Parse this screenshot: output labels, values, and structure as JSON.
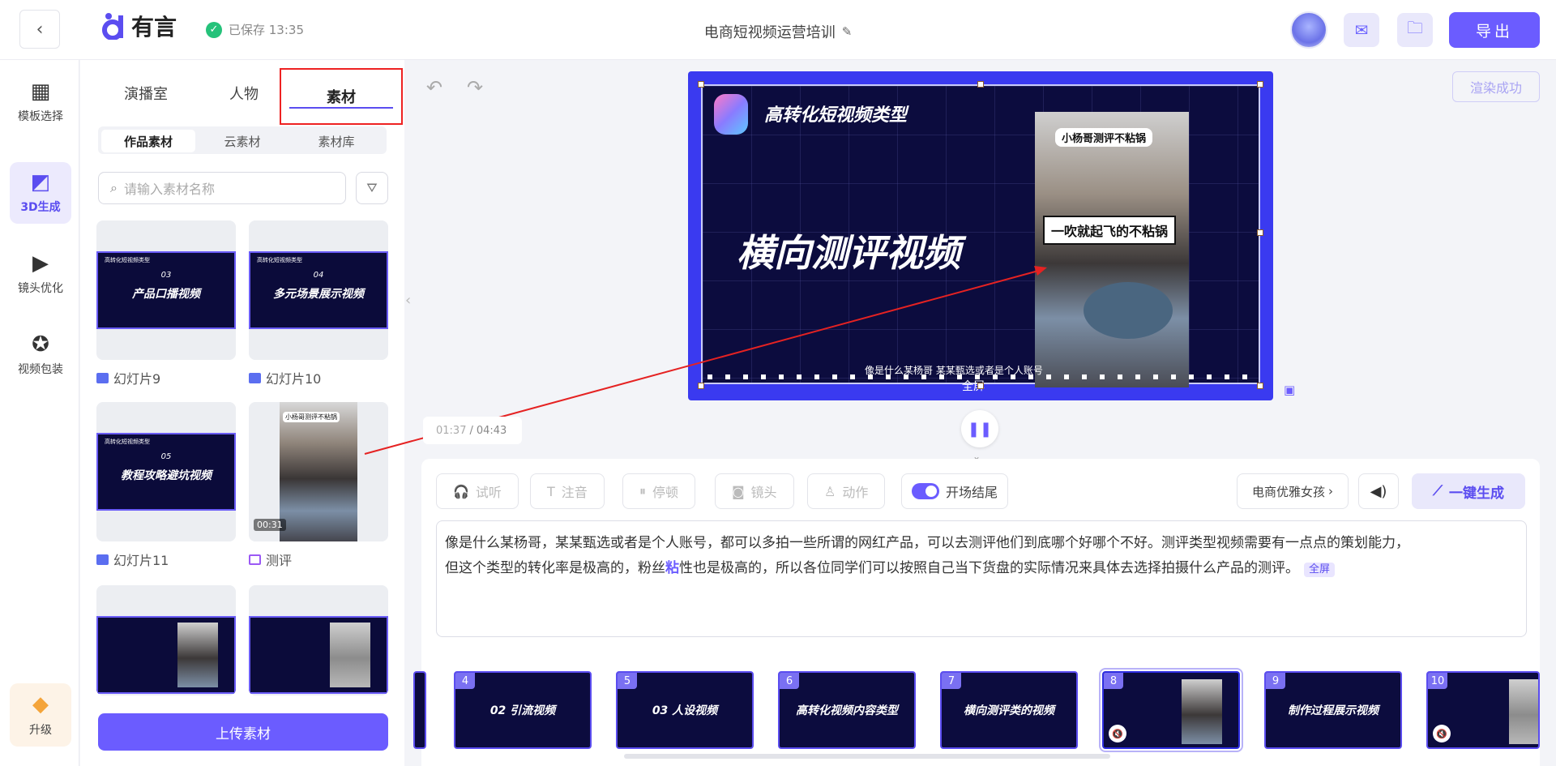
{
  "header": {
    "logo_text": "有言",
    "saved_text": "已保存 13:35",
    "project_title": "电商短视频运营培训",
    "export_label": "导出"
  },
  "rail": {
    "items": [
      {
        "label": "模板选择"
      },
      {
        "label": "3D生成"
      },
      {
        "label": "镜头优化"
      },
      {
        "label": "视频包装"
      }
    ],
    "upgrade_label": "升级"
  },
  "panel": {
    "tabs": [
      {
        "label": "演播室"
      },
      {
        "label": "人物"
      },
      {
        "label": "素材"
      }
    ],
    "segments": [
      {
        "label": "作品素材"
      },
      {
        "label": "云素材"
      },
      {
        "label": "素材库"
      }
    ],
    "search_placeholder": "请输入素材名称",
    "cards": [
      {
        "label": "幻灯片9",
        "slide_title": "高转化短视频类型",
        "slide_num": "03",
        "slide_main": "产品口播视频"
      },
      {
        "label": "幻灯片10",
        "slide_title": "高转化短视频类型",
        "slide_num": "04",
        "slide_main": "多元场景展示视频"
      },
      {
        "label": "幻灯片11",
        "slide_title": "高转化短视频类型",
        "slide_num": "05",
        "slide_main": "教程攻略避坑视频"
      },
      {
        "label": "测评",
        "duration": "00:31",
        "video_caption": "小杨哥测评不粘锅"
      }
    ],
    "upload_label": "上传素材"
  },
  "canvas": {
    "render_status": "渲染成功",
    "title": "高转化短视频类型",
    "headline": "横向测评视频",
    "bubble_top": "小杨哥测评不粘锅",
    "bubble_main": "一吹就起飞的不粘锅",
    "subtitle": "像是什么某杨哥 某某甄选或者是个人账号",
    "fullscreen_label": "全屏",
    "time_current": "01:37",
    "time_total": "04:43"
  },
  "editor": {
    "tools": [
      {
        "label": "试听"
      },
      {
        "label": "注音"
      },
      {
        "label": "停顿"
      },
      {
        "label": "镜头"
      },
      {
        "label": "动作"
      },
      {
        "label": "开场结尾"
      }
    ],
    "voice_label": "电商优雅女孩",
    "generate_label": "一键生成",
    "text_line1": "像是什么某杨哥，某某甄选或者是个人账号，都可以多拍一些所谓的网红产品，可以去测评他们到底哪个好哪个不好。测评类型视频需要有一点点的策划能力，",
    "text_line2_a": "但这个类型的转化率是极高的，粉丝",
    "text_line2_hl": "粘",
    "text_line2_b": "性也是极高的，所以各位同学们可以按照自己当下货盘的实际情况来具体去选择拍摄什么产品的测评。",
    "fullscreen_tag": "全屏"
  },
  "timeline": {
    "thumbs": [
      {
        "num": "4",
        "text": "02 引流视频"
      },
      {
        "num": "5",
        "text": "03 人设视频"
      },
      {
        "num": "6",
        "text": "高转化视频内容类型"
      },
      {
        "num": "7",
        "text": "横向测评类的视频"
      },
      {
        "num": "8",
        "text": ""
      },
      {
        "num": "9",
        "text": "制作过程展示视频"
      },
      {
        "num": "10",
        "text": ""
      }
    ]
  },
  "colors": {
    "accent": "#6b5cff",
    "canvas_bg": "#0c0c3e",
    "highlight_box": "#ee2222",
    "saved_check": "#25c27a"
  }
}
